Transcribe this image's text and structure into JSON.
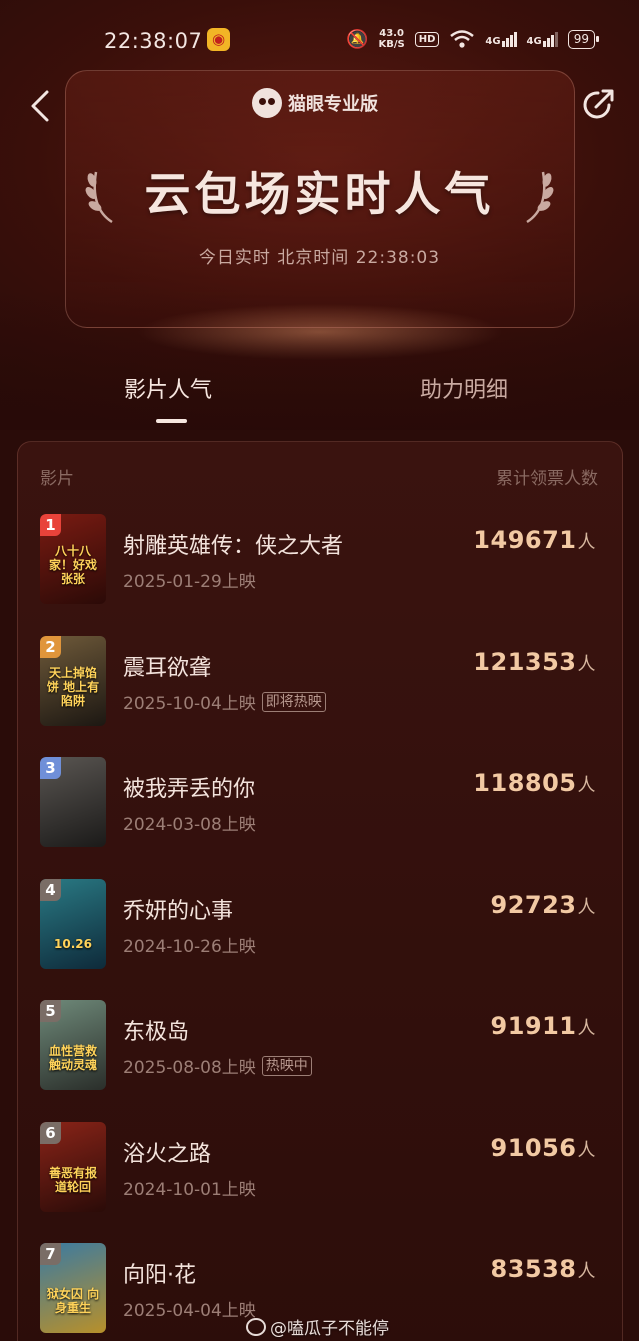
{
  "status_bar": {
    "time": "22:38:07",
    "net_speed_value": "43.0",
    "net_speed_unit": "KB/S",
    "hd_label": "HD",
    "signal1_label": "4G",
    "signal2_label": "4G",
    "battery": "99"
  },
  "header": {
    "brand_name": "猫眼专业版"
  },
  "hero": {
    "title": "云包场实时人气",
    "subtitle": "今日实时 北京时间 22:38:03"
  },
  "tabs": [
    {
      "label": "影片人气",
      "active": true
    },
    {
      "label": "助力明细",
      "active": false
    }
  ],
  "table": {
    "col_left": "影片",
    "col_right": "累计领票人数",
    "unit": "人",
    "rows": [
      {
        "rank": "1",
        "title": "射雕英雄传：侠之大者",
        "release": "2025-01-29上映",
        "badge": "",
        "count": "149671",
        "poster_text": "八十八家！好戏张张",
        "poster_colors": [
          "#7a1b12",
          "#2b0a07"
        ],
        "rank_color": "#e8433a"
      },
      {
        "rank": "2",
        "title": "震耳欲聋",
        "release": "2025-10-04上映",
        "badge": "即将热映",
        "count": "121353",
        "poster_text": "天上掉馅饼 地上有陷阱",
        "poster_colors": [
          "#6f5a3a",
          "#1c1712"
        ],
        "rank_color": "#e0953b"
      },
      {
        "rank": "3",
        "title": "被我弄丢的你",
        "release": "2024-03-08上映",
        "badge": "",
        "count": "118805",
        "poster_text": "",
        "poster_colors": [
          "#5a5652",
          "#1b1a19"
        ],
        "rank_color": "#6f8fd8"
      },
      {
        "rank": "4",
        "title": "乔妍的心事",
        "release": "2024-10-26上映",
        "badge": "",
        "count": "92723",
        "poster_text": "10.26",
        "poster_colors": [
          "#2a7a84",
          "#0e2a3a"
        ],
        "rank_color": "#7a6d66"
      },
      {
        "rank": "5",
        "title": "东极岛",
        "release": "2025-08-08上映",
        "badge": "热映中",
        "count": "91911",
        "poster_text": "血性营救 触动灵魂",
        "poster_colors": [
          "#6f8a7a",
          "#2a2e2a"
        ],
        "rank_color": "#7a6d66"
      },
      {
        "rank": "6",
        "title": "浴火之路",
        "release": "2024-10-01上映",
        "badge": "",
        "count": "91056",
        "poster_text": "善恶有报 道轮回",
        "poster_colors": [
          "#8a2418",
          "#2a0b08"
        ],
        "rank_color": "#7a6d66"
      },
      {
        "rank": "7",
        "title": "向阳·花",
        "release": "2025-04-04上映",
        "badge": "",
        "count": "83538",
        "poster_text": "狱女囚 向身重生",
        "poster_colors": [
          "#3a7aa2",
          "#b8902a"
        ],
        "rank_color": "#7a6d66"
      }
    ]
  },
  "watermark": "@嗑瓜子不能停"
}
